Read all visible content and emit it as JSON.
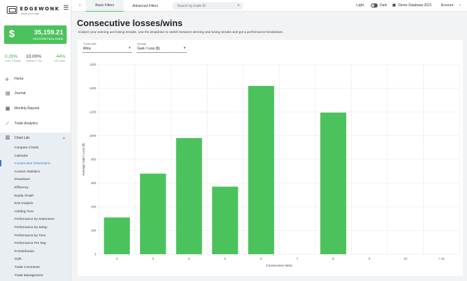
{
  "app": {
    "logo_text": "EDGEWONK",
    "logo_sub": "unlock your edge",
    "menu_icon": "hamburger-icon"
  },
  "balance": {
    "symbol": "$",
    "value": "35,159.21",
    "label": "ACCOUNT BALANCE"
  },
  "stats": [
    {
      "value": "0.29%",
      "label": "LAST TRADE"
    },
    {
      "value": "10.00%",
      "label": "WEEKLY TILT"
    },
    {
      "value": "44%",
      "label": "RETURN"
    }
  ],
  "nav": {
    "home": {
      "label": "Home",
      "icon": "home-icon"
    },
    "journal": {
      "label": "Journal",
      "icon": "book-icon"
    },
    "monthly": {
      "label": "Monthly Reports",
      "icon": "calendar-icon"
    },
    "trade_analytics": {
      "label": "Trade Analytics",
      "icon": "chart-line-icon"
    },
    "chart_lab": {
      "label": "Chart Lab",
      "icon": "chart-bar-icon"
    }
  },
  "chart_lab_items": [
    "Compare Charts",
    "Calendar",
    "Consecutive losses/wins",
    "Custom Statistics",
    "Drawdown",
    "Efficiency",
    "Equity Graph",
    "Exit Analysis",
    "Holding Time",
    "Performance by Instrument",
    "Performance by Setup",
    "Performance by Time",
    "Performance Per Day",
    "R-Distribution",
    "SQN",
    "Trade Comments",
    "Trade Management"
  ],
  "chart_lab_active_index": 2,
  "topbar": {
    "tabs": [
      "Basic Filters",
      "Advanced Filters"
    ],
    "search_placeholder": "Search by trade ID",
    "light_label": "Light",
    "dark_label": "Dark",
    "database": "Demo Database 2021",
    "account": "Account"
  },
  "page": {
    "title": "Consecutive losses/wins",
    "description": "Analyze your winning and losing streaks. Use the dropdown to switch between winning and losing streaks and get a performance breakdown."
  },
  "filters": {
    "consecutive": {
      "label": "Consecutive",
      "value": "Wins"
    },
    "average": {
      "label": "Average",
      "value": "Gain / Loss ($)"
    }
  },
  "colors": {
    "accent": "#4cc25c",
    "bar": "#4cc25c",
    "link_active": "#2a7fd4"
  },
  "chart_data": {
    "type": "bar",
    "categories": [
      "2",
      "3",
      "4",
      "5",
      "6",
      "7",
      "8",
      "9",
      "10",
      "> 10"
    ],
    "values": [
      310,
      680,
      980,
      570,
      1420,
      0,
      1195,
      0,
      0,
      0
    ],
    "xlabel": "Consecutive Wins",
    "ylabel": "Average Gain / Loss ($)",
    "ylim": [
      0,
      1600
    ],
    "yticks": [
      0,
      200,
      400,
      600,
      800,
      1000,
      1200,
      1400,
      1600
    ],
    "grid": true
  }
}
